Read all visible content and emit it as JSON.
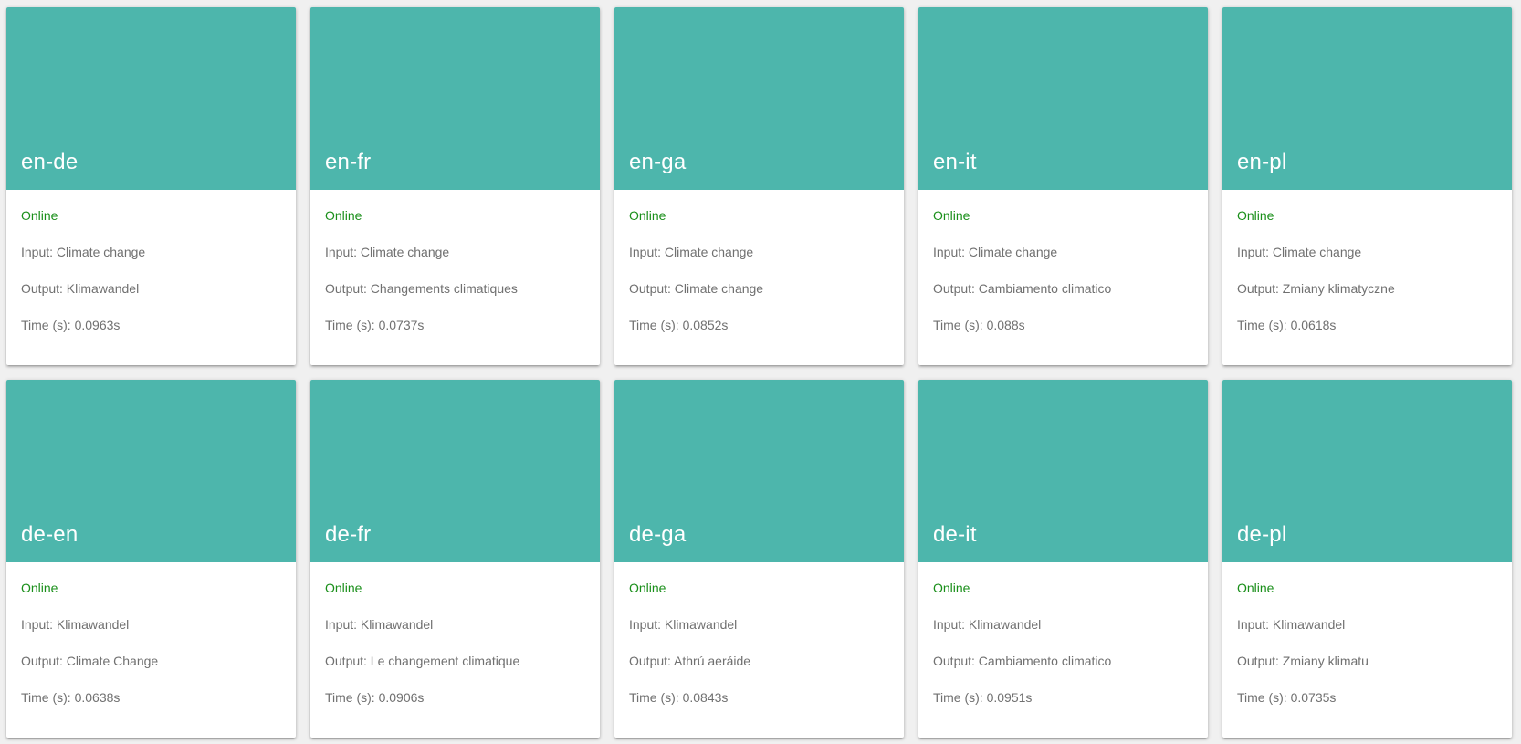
{
  "colors": {
    "card_header": "#4db6ac",
    "status_online": "#1a8f1a",
    "text_muted": "#707070",
    "background": "#f0f0f0"
  },
  "cards": [
    {
      "title": "en-de",
      "status": "Online",
      "input": "Input: Climate change",
      "output": "Output: Klimawandel",
      "time": "Time (s): 0.0963s"
    },
    {
      "title": "en-fr",
      "status": "Online",
      "input": "Input: Climate change",
      "output": "Output: Changements climatiques",
      "time": "Time (s): 0.0737s"
    },
    {
      "title": "en-ga",
      "status": "Online",
      "input": "Input: Climate change",
      "output": "Output: Climate change",
      "time": "Time (s): 0.0852s"
    },
    {
      "title": "en-it",
      "status": "Online",
      "input": "Input: Climate change",
      "output": "Output: Cambiamento climatico",
      "time": "Time (s): 0.088s"
    },
    {
      "title": "en-pl",
      "status": "Online",
      "input": "Input: Climate change",
      "output": "Output: Zmiany klimatyczne",
      "time": "Time (s): 0.0618s"
    },
    {
      "title": "de-en",
      "status": "Online",
      "input": "Input: Klimawandel",
      "output": "Output: Climate Change",
      "time": "Time (s): 0.0638s"
    },
    {
      "title": "de-fr",
      "status": "Online",
      "input": "Input: Klimawandel",
      "output": "Output: Le changement climatique",
      "time": "Time (s): 0.0906s"
    },
    {
      "title": "de-ga",
      "status": "Online",
      "input": "Input: Klimawandel",
      "output": "Output: Athrú aeráide",
      "time": "Time (s): 0.0843s"
    },
    {
      "title": "de-it",
      "status": "Online",
      "input": "Input: Klimawandel",
      "output": "Output: Cambiamento climatico",
      "time": "Time (s): 0.0951s"
    },
    {
      "title": "de-pl",
      "status": "Online",
      "input": "Input: Klimawandel",
      "output": "Output: Zmiany klimatu",
      "time": "Time (s): 0.0735s"
    }
  ]
}
